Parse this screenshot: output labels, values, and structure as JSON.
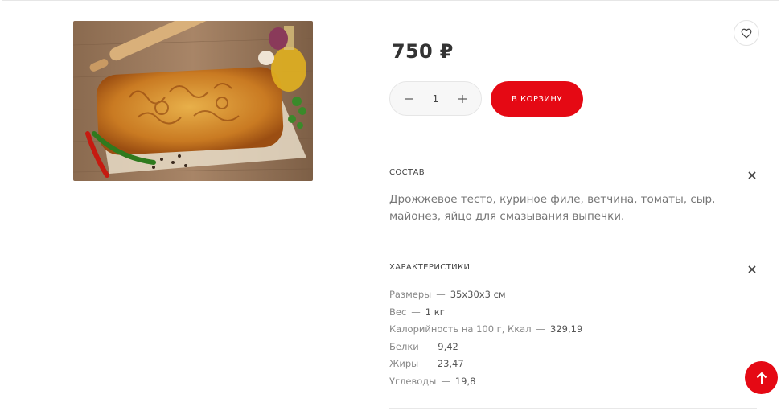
{
  "product": {
    "price": "750 ₽",
    "quantity": "1",
    "add_to_cart": "В КОРЗИНУ"
  },
  "composition": {
    "title": "СОСТАВ",
    "text": "Дрожжевое тесто, куриное филе, ветчина, томаты, сыр, майонез, яйцо для смазывания выпечки."
  },
  "characteristics": {
    "title": "ХАРАКТЕРИСТИКИ",
    "items": [
      {
        "label": "Размеры",
        "value": "35х30х3 см"
      },
      {
        "label": "Вес",
        "value": "1 кг"
      },
      {
        "label": "Калорийность на 100 г, Ккал",
        "value": "329,19"
      },
      {
        "label": "Белки",
        "value": "9,42"
      },
      {
        "label": "Жиры",
        "value": "23,47"
      },
      {
        "label": "Углеводы",
        "value": "19,8"
      }
    ]
  },
  "icons": {
    "favorite": "heart-icon",
    "minus": "minus-icon",
    "plus": "plus-icon",
    "close": "close-icon",
    "scroll_top": "arrow-up-icon"
  },
  "colors": {
    "accent": "#e50914"
  }
}
